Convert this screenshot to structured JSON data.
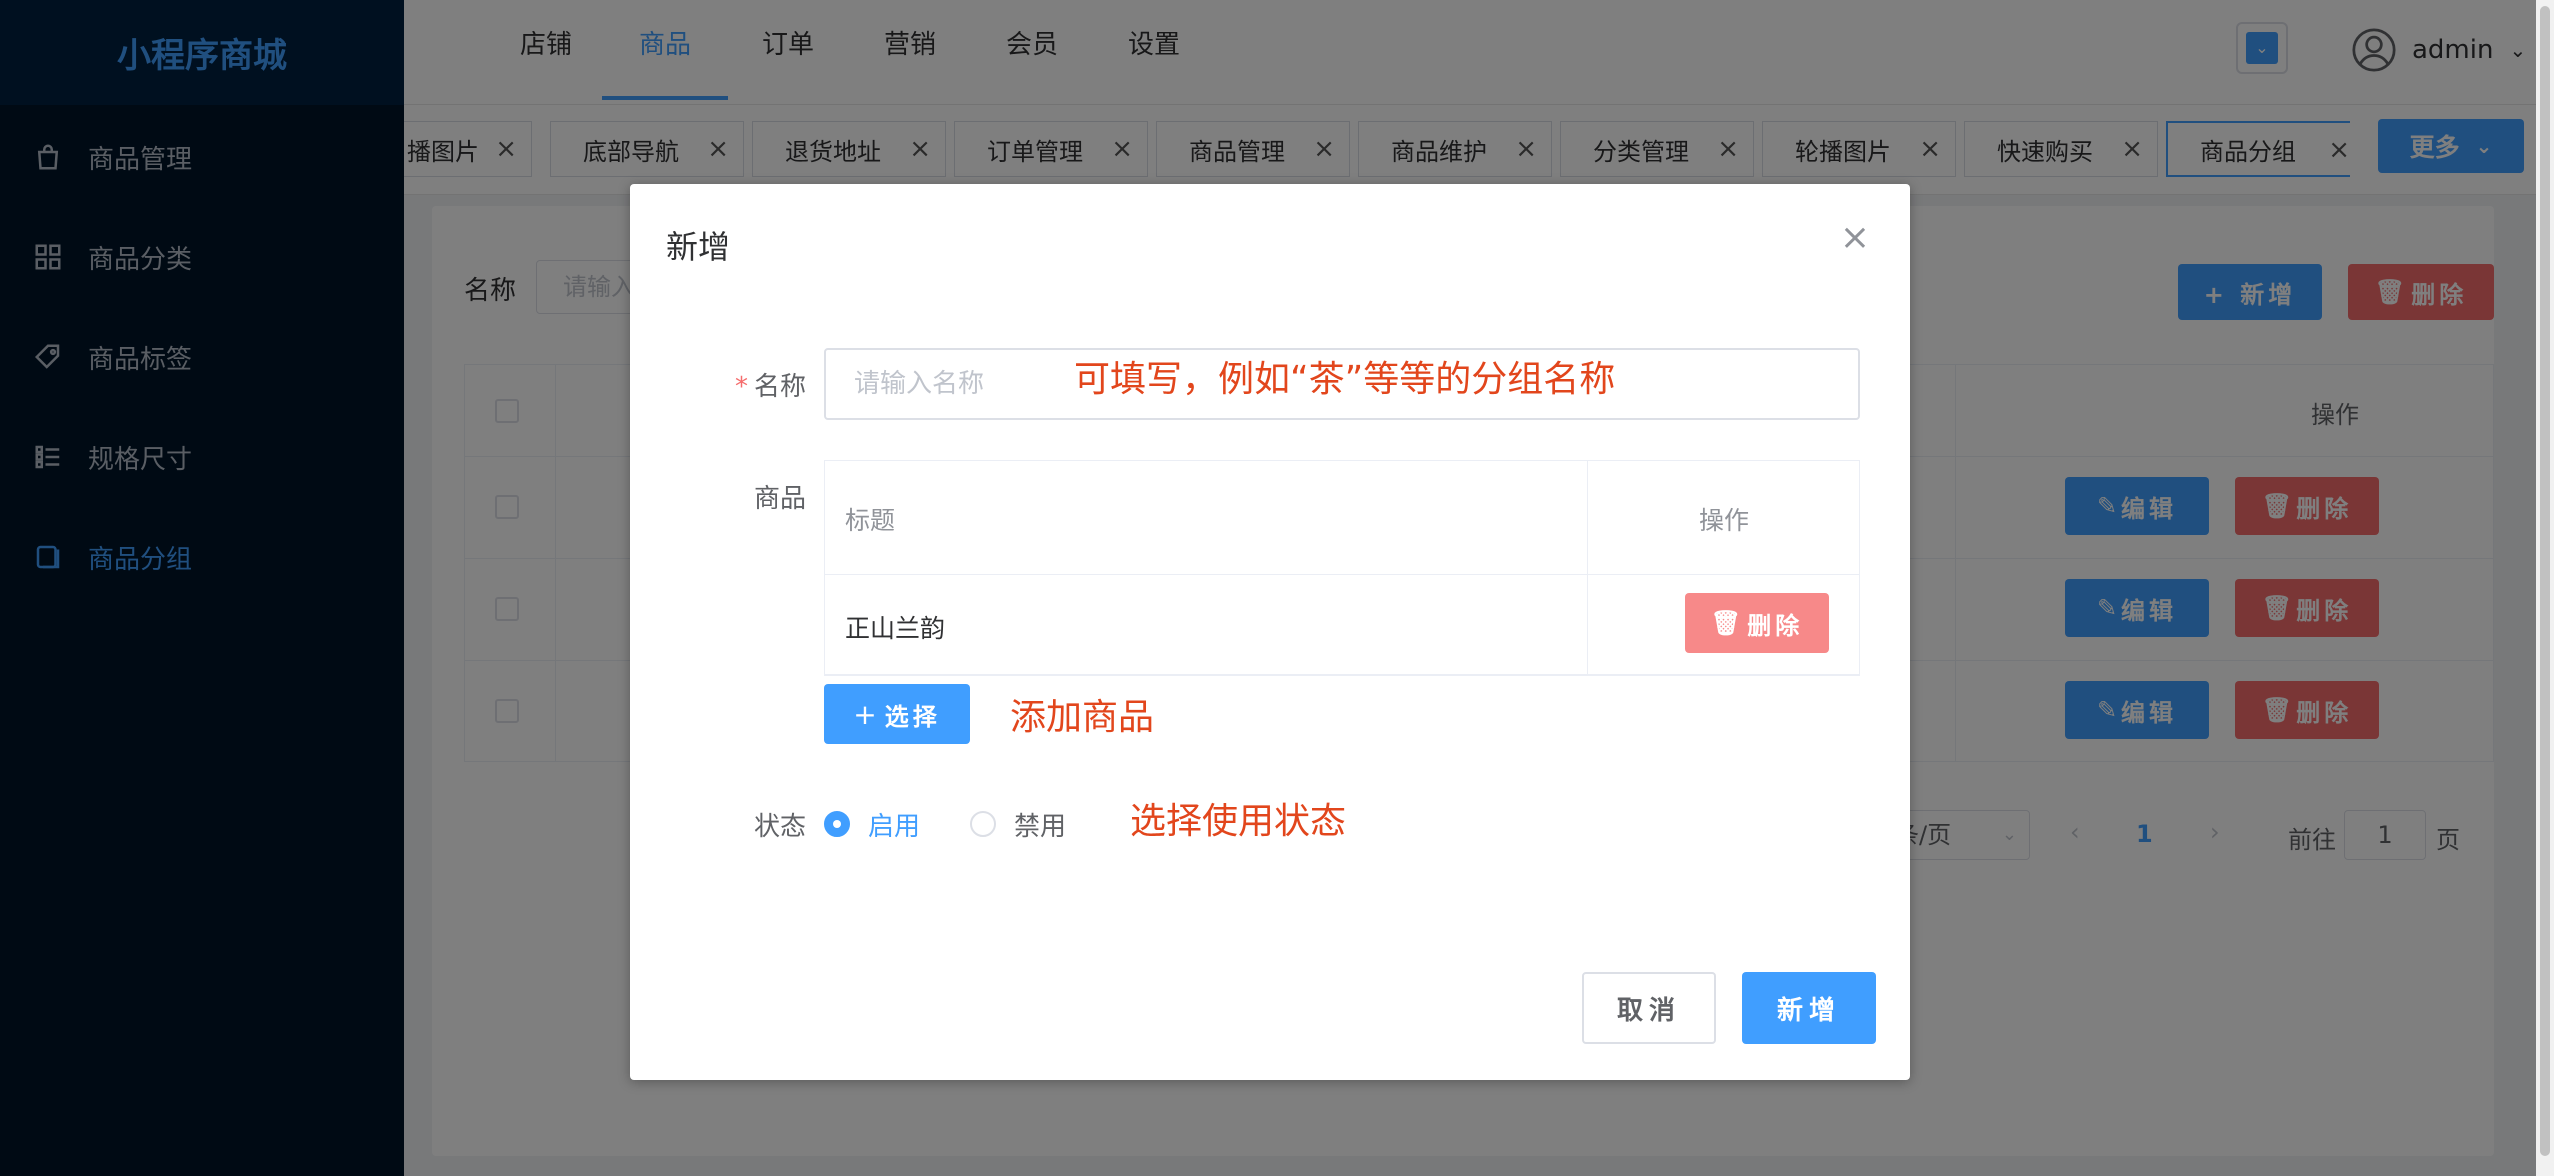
{
  "app": {
    "title": "小程序商城"
  },
  "sidebar": {
    "items": [
      {
        "label": "商品管理",
        "icon": "bag-icon"
      },
      {
        "label": "商品分类",
        "icon": "grid-icon"
      },
      {
        "label": "商品标签",
        "icon": "tag-icon"
      },
      {
        "label": "规格尺寸",
        "icon": "list-icon"
      },
      {
        "label": "商品分组",
        "icon": "copy-icon",
        "active": true
      }
    ]
  },
  "header": {
    "tabs": [
      {
        "label": "店铺"
      },
      {
        "label": "商品",
        "active": true
      },
      {
        "label": "订单"
      },
      {
        "label": "营销"
      },
      {
        "label": "会员"
      },
      {
        "label": "设置"
      }
    ],
    "user": "admin"
  },
  "tagbar": {
    "tags": [
      {
        "label": "播图片"
      },
      {
        "label": "底部导航"
      },
      {
        "label": "退货地址"
      },
      {
        "label": "订单管理"
      },
      {
        "label": "商品管理"
      },
      {
        "label": "商品维护"
      },
      {
        "label": "分类管理"
      },
      {
        "label": "轮播图片"
      },
      {
        "label": "快速购买"
      },
      {
        "label": "商品分组",
        "active": true
      }
    ],
    "more_label": "更多"
  },
  "page": {
    "search_label": "名称",
    "search_placeholder": "请输入",
    "add_label": "+ 新增",
    "delete_label": "删除",
    "op_header": "操作",
    "row_edit_label": "编辑",
    "row_delete_label": "删除",
    "pager": {
      "page_size": "条/页",
      "current": "1",
      "goto_prefix": "前往",
      "goto_value": "1",
      "goto_suffix": "页"
    }
  },
  "dialog": {
    "title": "新增",
    "name_label": "名称",
    "name_placeholder": "请输入名称",
    "name_annotation": "可填写，例如“茶”等等的分组名称",
    "goods_label": "商品",
    "goods_table": {
      "headers": [
        "标题",
        "操作"
      ],
      "rows": [
        {
          "title": "正山兰韵"
        }
      ],
      "delete_label": "删除"
    },
    "choose_label": "选择",
    "choose_annotation": "添加商品",
    "status_label": "状态",
    "status_options": [
      {
        "label": "启用",
        "checked": true
      },
      {
        "label": "禁用",
        "checked": false
      }
    ],
    "status_annotation": "选择使用状态",
    "cancel_label": "取消",
    "confirm_label": "新增"
  },
  "colors": {
    "primary": "#409eff",
    "danger": "#f56c6c",
    "sidebar": "#001529",
    "annotation": "#e2461c"
  }
}
